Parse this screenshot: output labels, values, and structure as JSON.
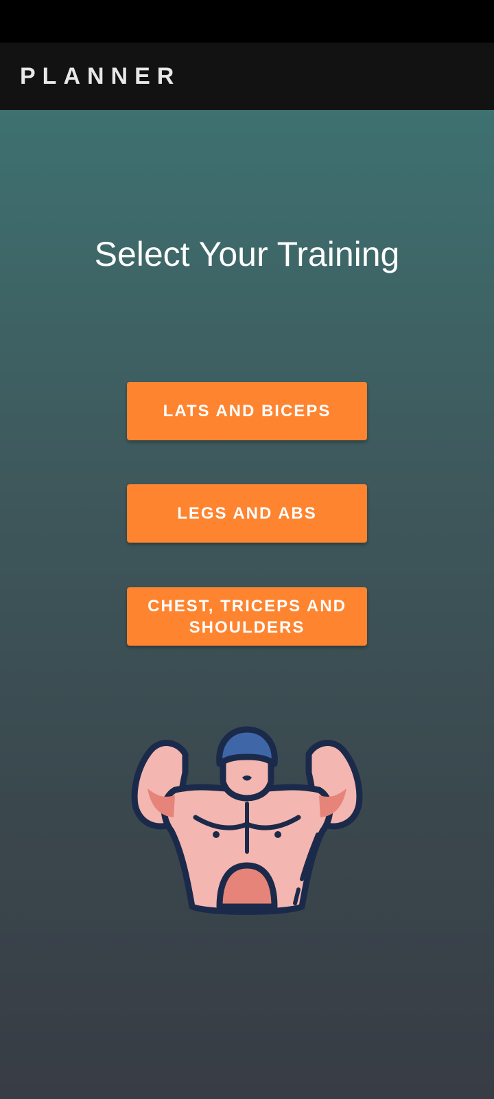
{
  "app_bar": {
    "title": "PLANNER"
  },
  "main": {
    "heading": "Select Your Training",
    "buttons": [
      {
        "label": "LATS AND BICEPS"
      },
      {
        "label": "LEGS AND ABS"
      },
      {
        "label": "CHEST, TRICEPS AND SHOULDERS"
      }
    ],
    "illustration": {
      "icon": "bodybuilder-flexing-icon"
    }
  },
  "colors": {
    "button": "#fe8430",
    "app_bar": "#121212",
    "background_top": "#3e7170",
    "background_bottom": "#383c45"
  }
}
